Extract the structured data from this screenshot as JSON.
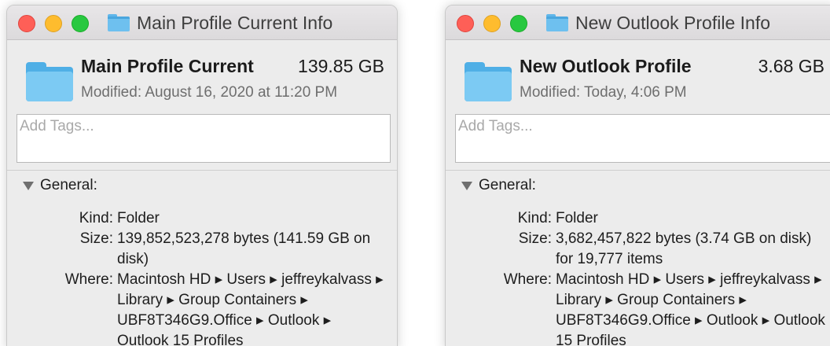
{
  "windows": [
    {
      "title": "Main Profile Current Info",
      "name": "Main Profile Current",
      "size": "139.85 GB",
      "modified": "Modified: August 16, 2020 at 11:20 PM",
      "tags_placeholder": "Add Tags...",
      "section": "General:",
      "kind_label": "Kind:",
      "kind": "Folder",
      "size_label": "Size:",
      "size_detail": "139,852,523,278 bytes (141.59 GB on disk)",
      "where_label": "Where:",
      "where": "Macintosh HD ▸ Users ▸ jeffreykalvass ▸ Library ▸ Group Containers ▸ UBF8T346G9.Office ▸ Outlook ▸ Outlook 15 Profiles"
    },
    {
      "title": "New Outlook Profile Info",
      "name": "New Outlook Profile",
      "size": "3.68 GB",
      "modified": "Modified: Today, 4:06 PM",
      "tags_placeholder": "Add Tags...",
      "section": "General:",
      "kind_label": "Kind:",
      "kind": "Folder",
      "size_label": "Size:",
      "size_detail": "3,682,457,822 bytes (3.74 GB on disk) for 19,777 items",
      "where_label": "Where:",
      "where": "Macintosh HD ▸ Users ▸ jeffreykalvass ▸ Library ▸ Group Containers ▸ UBF8T346G9.Office ▸ Outlook ▸ Outlook 15 Profiles"
    }
  ],
  "colors": {
    "close": "#fe5f57",
    "minimize": "#febc2e",
    "maximize": "#28c840",
    "folder": "#7ccaf3"
  }
}
